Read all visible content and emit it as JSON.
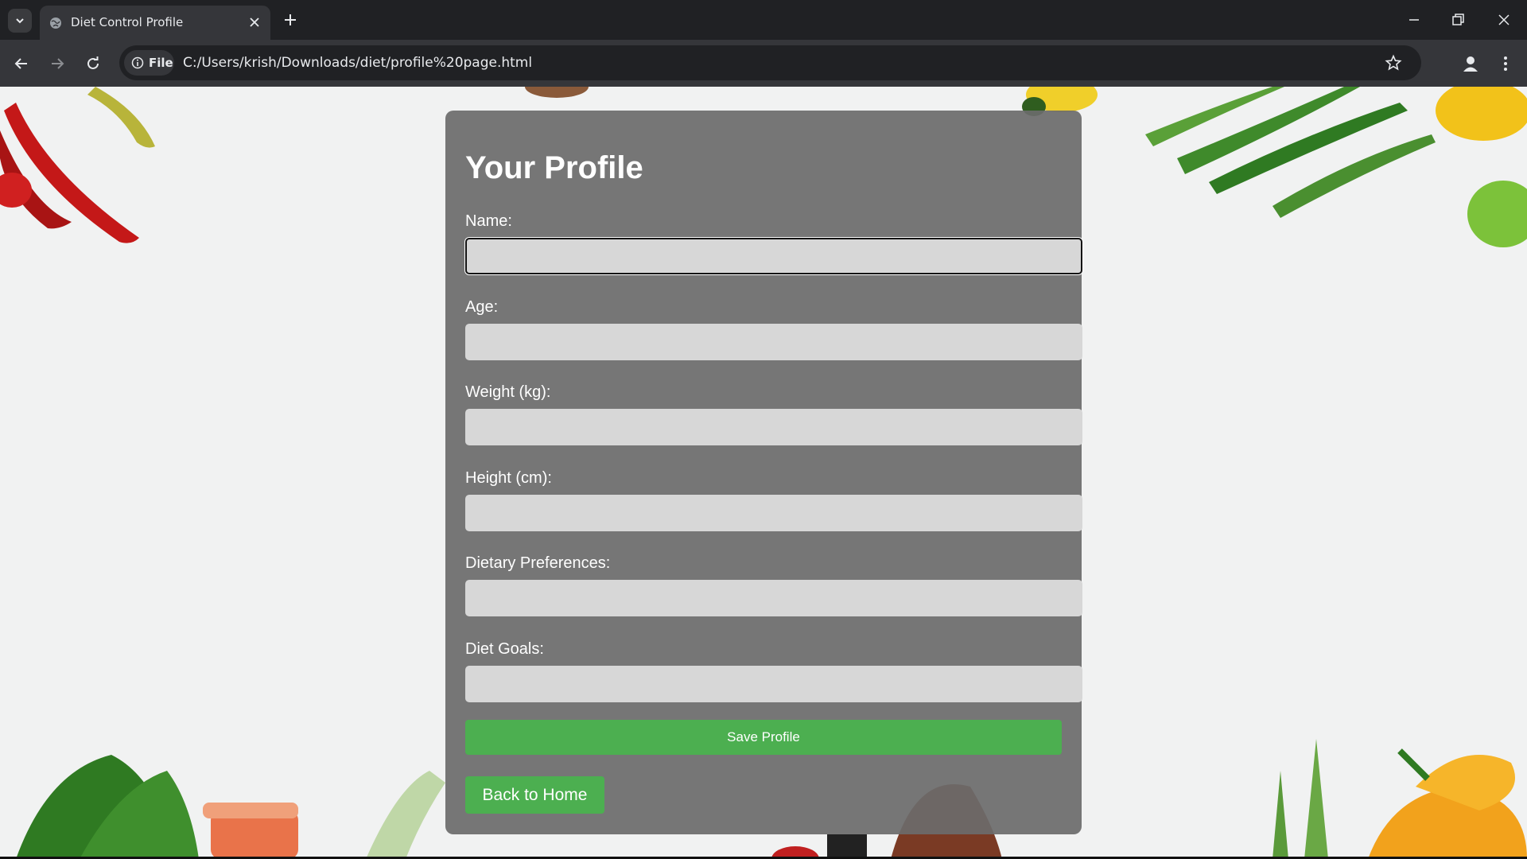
{
  "browser": {
    "tab_title": "Diet Control Profile",
    "address_chip": "File",
    "url": "C:/Users/krish/Downloads/diet/profile%20page.html"
  },
  "icons": {
    "tab_search": "chevron-down-icon",
    "favicon": "globe-icon",
    "tab_close": "close-icon",
    "new_tab": "plus-icon",
    "minimize": "minimize-icon",
    "restore": "restore-icon",
    "close_window": "close-icon",
    "back": "arrow-left-icon",
    "forward": "arrow-right-icon",
    "reload": "reload-icon",
    "site_info": "info-icon",
    "bookmark": "star-icon",
    "profile": "person-icon",
    "menu": "kebab-menu-icon"
  },
  "profile": {
    "title": "Your Profile",
    "fields": [
      {
        "label": "Name:",
        "value": ""
      },
      {
        "label": "Age:",
        "value": ""
      },
      {
        "label": "Weight (kg):",
        "value": ""
      },
      {
        "label": "Height (cm):",
        "value": ""
      },
      {
        "label": "Dietary Preferences:",
        "value": ""
      },
      {
        "label": "Diet Goals:",
        "value": ""
      }
    ],
    "save_label": "Save Profile",
    "home_label": "Back to Home"
  },
  "colors": {
    "accent_green": "#4caf50",
    "card_background": "#6b6b6b",
    "input_background": "#d7d7d7"
  }
}
